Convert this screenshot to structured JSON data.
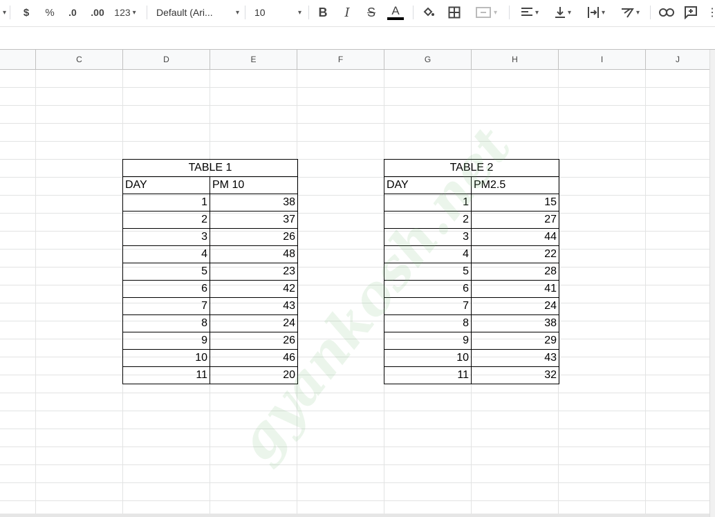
{
  "toolbar": {
    "currency_label": "$",
    "percent_label": "%",
    "decrease_decimal_label": ".0",
    "increase_decimal_label": ".00",
    "more_formats_label": "123",
    "font_family": "Default (Ari...",
    "font_size": "10",
    "text_color_accent": "#000000"
  },
  "columns": [
    "C",
    "D",
    "E",
    "F",
    "G",
    "H",
    "I",
    "J"
  ],
  "table1": {
    "title": "TABLE 1",
    "headers": [
      "DAY",
      "PM 10"
    ],
    "rows": [
      [
        "1",
        "38"
      ],
      [
        "2",
        "37"
      ],
      [
        "3",
        "26"
      ],
      [
        "4",
        "48"
      ],
      [
        "5",
        "23"
      ],
      [
        "6",
        "42"
      ],
      [
        "7",
        "43"
      ],
      [
        "8",
        "24"
      ],
      [
        "9",
        "26"
      ],
      [
        "10",
        "46"
      ],
      [
        "11",
        "20"
      ]
    ]
  },
  "table2": {
    "title": "TABLE 2",
    "headers": [
      "DAY",
      "PM2.5"
    ],
    "rows": [
      [
        "1",
        "15"
      ],
      [
        "2",
        "27"
      ],
      [
        "3",
        "44"
      ],
      [
        "4",
        "22"
      ],
      [
        "5",
        "28"
      ],
      [
        "6",
        "41"
      ],
      [
        "7",
        "24"
      ],
      [
        "8",
        "38"
      ],
      [
        "9",
        "29"
      ],
      [
        "10",
        "43"
      ],
      [
        "11",
        "32"
      ]
    ]
  },
  "watermark": "gyankosh.net"
}
